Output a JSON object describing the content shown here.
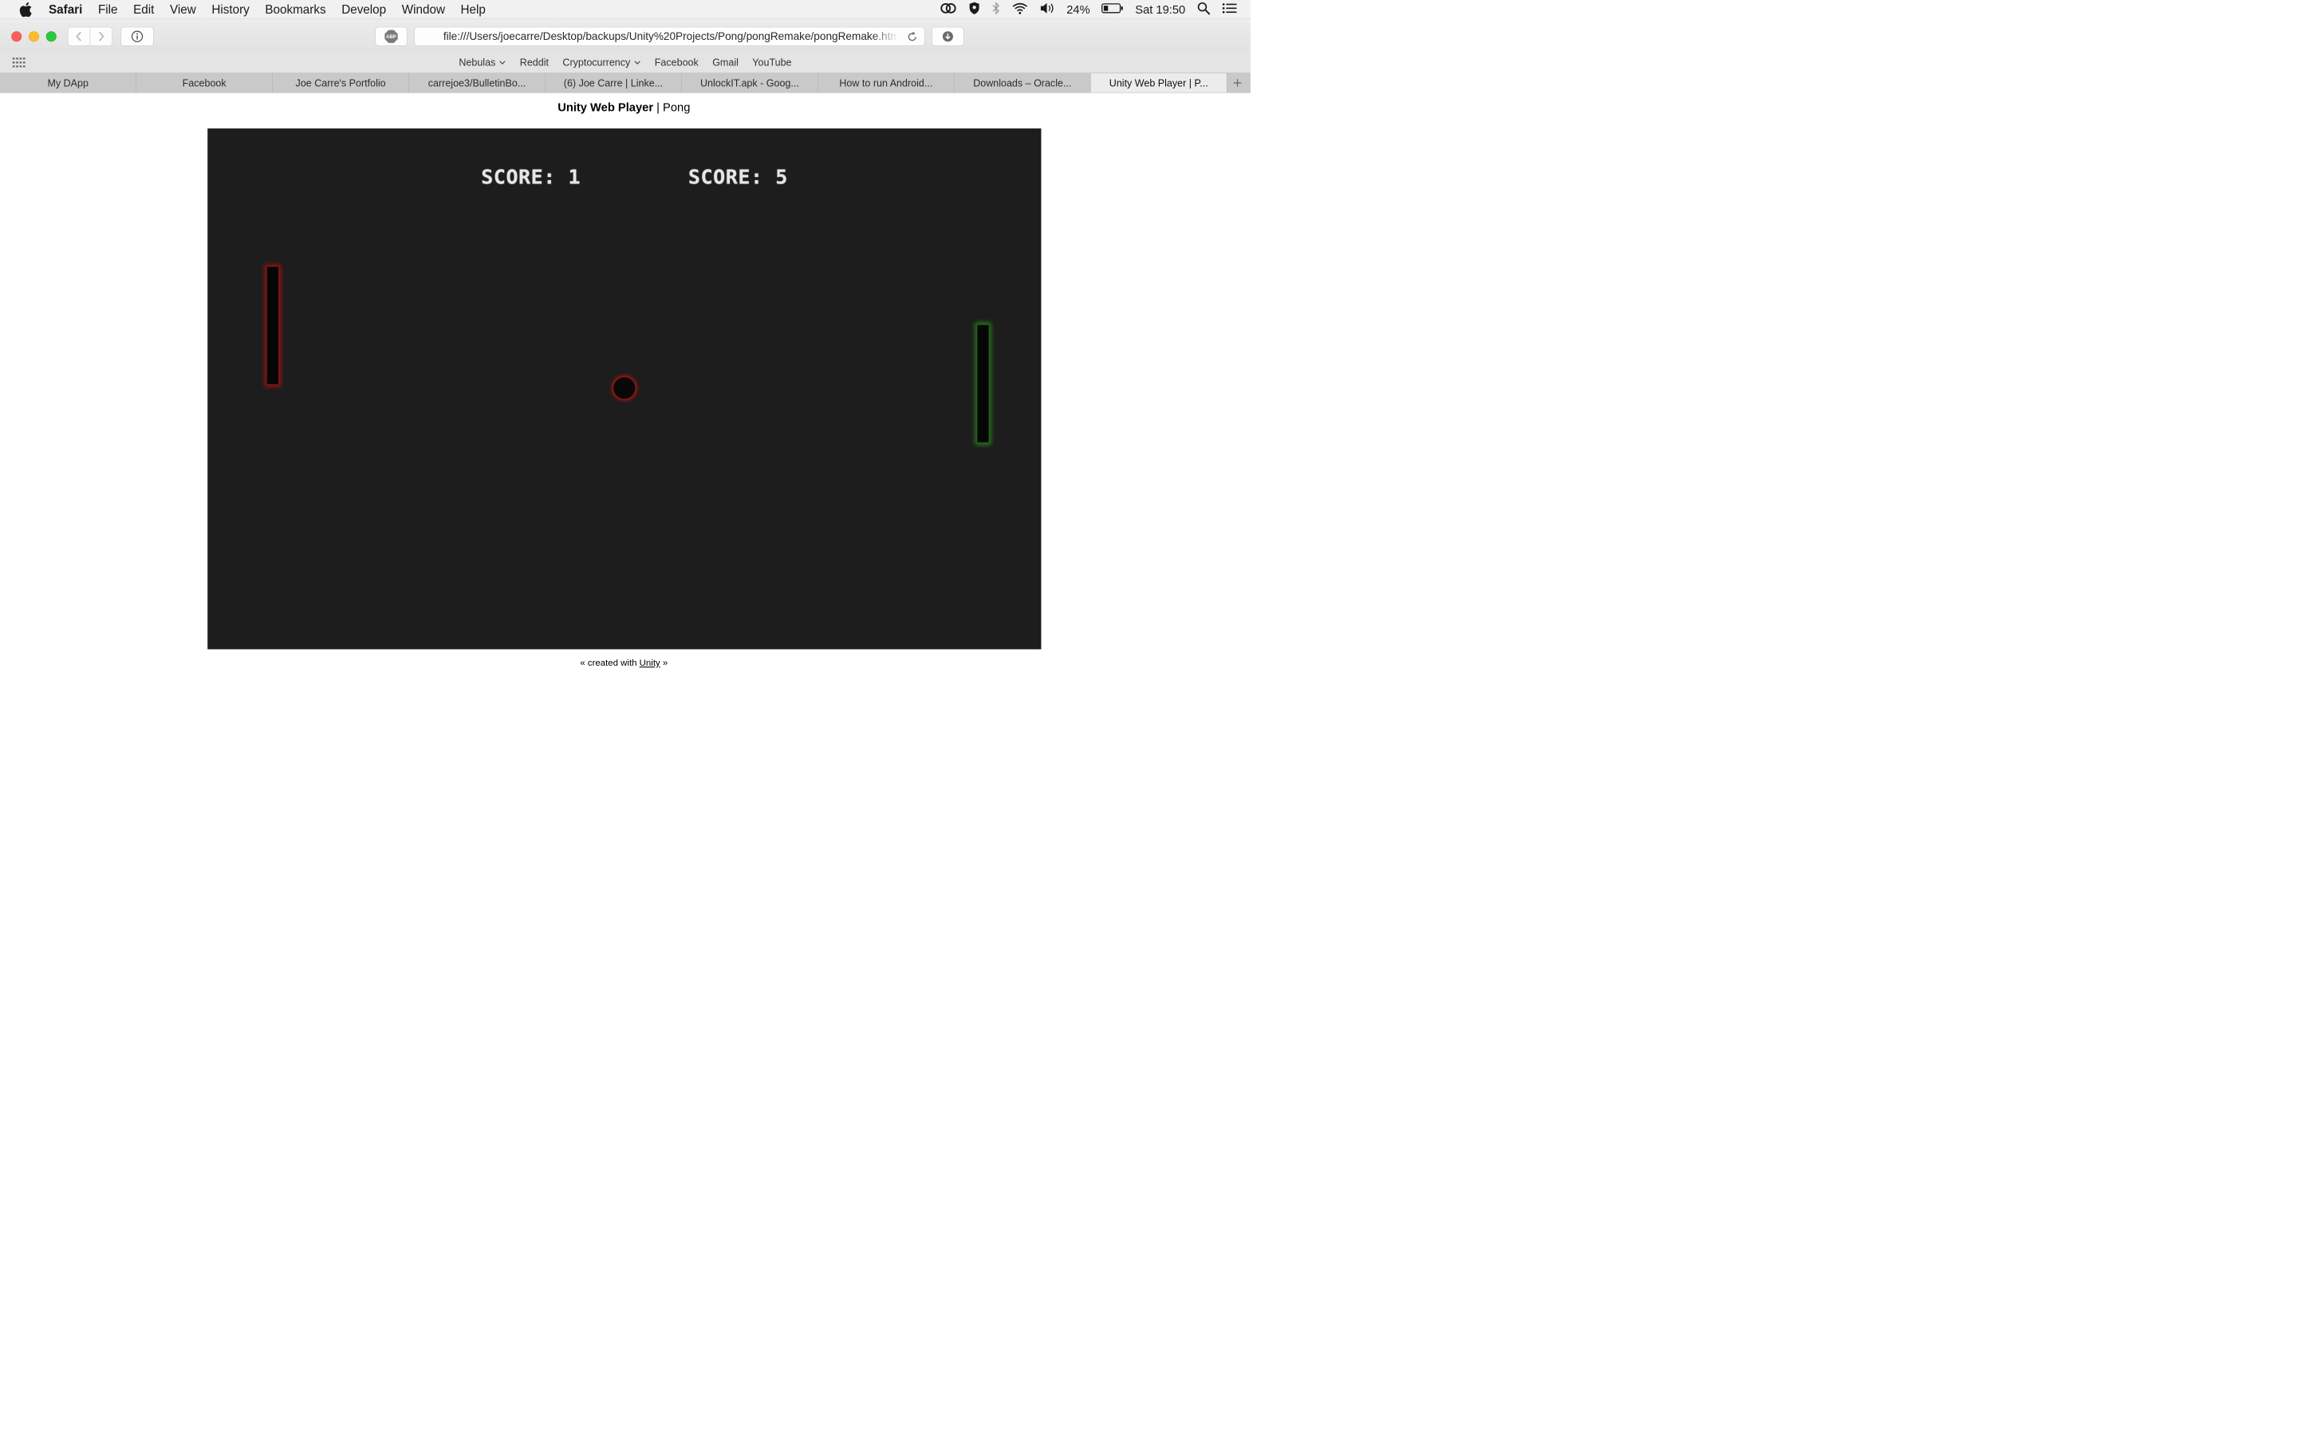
{
  "menubar": {
    "app_name": "Safari",
    "items": [
      "File",
      "Edit",
      "View",
      "History",
      "Bookmarks",
      "Develop",
      "Window",
      "Help"
    ],
    "battery": "24%",
    "clock": "Sat 19:50"
  },
  "toolbar": {
    "url": "file:///Users/joecarre/Desktop/backups/Unity%20Projects/Pong/pongRemake/pongRemake.html",
    "abp_label": "ABP"
  },
  "favorites": {
    "items": [
      {
        "label": "Nebulas",
        "dropdown": true
      },
      {
        "label": "Reddit",
        "dropdown": false
      },
      {
        "label": "Cryptocurrency",
        "dropdown": true
      },
      {
        "label": "Facebook",
        "dropdown": false
      },
      {
        "label": "Gmail",
        "dropdown": false
      },
      {
        "label": "YouTube",
        "dropdown": false
      }
    ]
  },
  "tabs": [
    {
      "label": "My DApp",
      "active": false
    },
    {
      "label": "Facebook",
      "active": false
    },
    {
      "label": "Joe Carre's Portfolio",
      "active": false
    },
    {
      "label": "carrejoe3/BulletinBo...",
      "active": false
    },
    {
      "label": "(6) Joe Carre | Linke...",
      "active": false
    },
    {
      "label": "UnlockIT.apk - Goog...",
      "active": false
    },
    {
      "label": "How to run Android...",
      "active": false
    },
    {
      "label": "Downloads – Oracle...",
      "active": false
    },
    {
      "label": "Unity Web Player | P...",
      "active": true
    }
  ],
  "page": {
    "title_strong": "Unity Web Player",
    "title_separator": " | ",
    "title_rest": "Pong",
    "footer_prefix": "« created with ",
    "footer_link": "Unity",
    "footer_suffix": " »"
  },
  "game": {
    "score_left": "SCORE: 1",
    "score_right": "SCORE: 5",
    "colors": {
      "background": "#1d1d1d",
      "left_paddle_glow": "#aa1414",
      "right_paddle_glow": "#2e8c1e",
      "ball_glow": "#b41414"
    }
  }
}
